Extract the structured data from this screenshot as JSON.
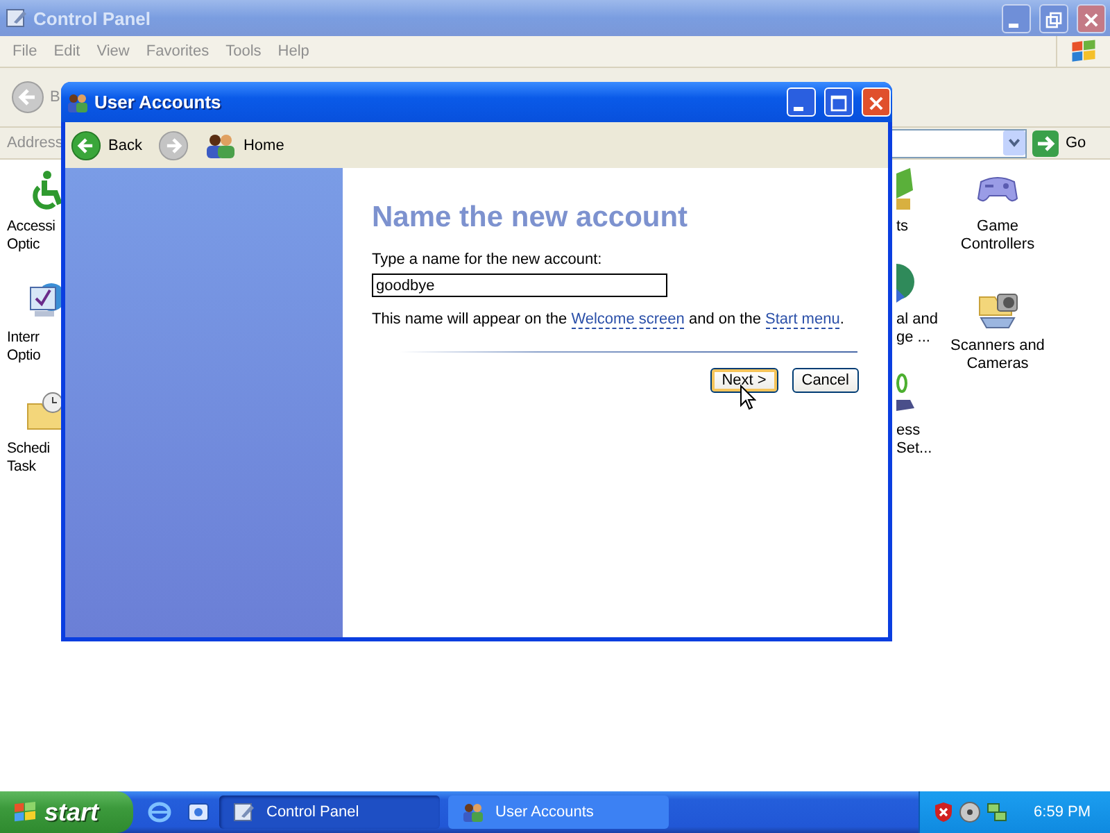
{
  "window": {
    "title": "Control Panel"
  },
  "menu": [
    "File",
    "Edit",
    "View",
    "Favorites",
    "Tools",
    "Help"
  ],
  "toolbar": {
    "back_label": "B"
  },
  "address": {
    "label": "Address",
    "go": "Go"
  },
  "left_icons": [
    {
      "kind": "accessibility",
      "lines": [
        "Accessi",
        "Optic"
      ]
    },
    {
      "kind": "internet",
      "lines": [
        "Interr",
        "Optio"
      ]
    },
    {
      "kind": "tasks",
      "lines": [
        "Schedi",
        "Task"
      ]
    }
  ],
  "right_cut_items": [
    {
      "kind": "tree",
      "lines": [
        "ts"
      ]
    },
    {
      "kind": "globe",
      "lines": [
        "al and",
        "ge ..."
      ]
    },
    {
      "kind": "phone",
      "lines": [
        "ess",
        "Set..."
      ]
    }
  ],
  "right_icons": [
    {
      "kind": "gamepad",
      "lines": [
        "Game",
        "Controllers"
      ]
    },
    {
      "kind": "scanner",
      "lines": [
        "Scanners and",
        "Cameras"
      ]
    }
  ],
  "dialog": {
    "title": "User Accounts",
    "back": "Back",
    "home": "Home",
    "heading": "Name the new account",
    "prompt": "Type a name for the new account:",
    "value": "goodbye",
    "note": [
      {
        "kind": "text",
        "text": "This name will appear on the "
      },
      {
        "kind": "link",
        "text": "Welcome screen"
      },
      {
        "kind": "text",
        "text": " and on the "
      },
      {
        "kind": "link",
        "text": "Start menu"
      },
      {
        "kind": "text",
        "text": "."
      }
    ],
    "buttons": [
      {
        "label": "Next >",
        "default": true
      },
      {
        "label": "Cancel",
        "default": false
      }
    ]
  },
  "taskbar": {
    "start": "start",
    "tasks": [
      {
        "label": "Control Panel",
        "kind": "control-panel",
        "selected": true
      },
      {
        "label": "User Accounts",
        "kind": "users",
        "selected": false
      }
    ],
    "clock": "6:59 PM"
  }
}
